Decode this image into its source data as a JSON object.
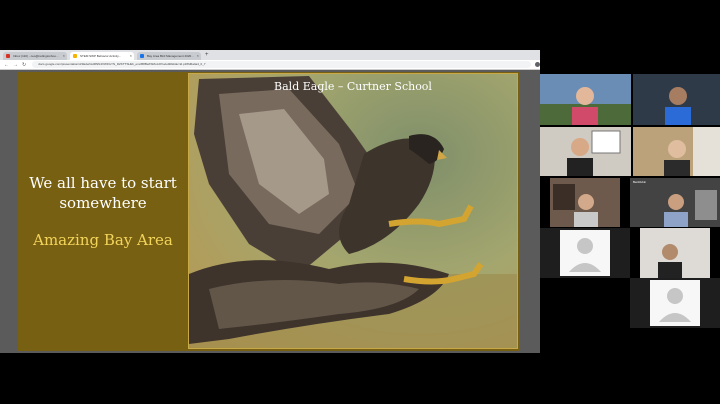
{
  "browser": {
    "tabs": [
      {
        "label": "Inbox (110) - ceo@redingtonboo..."
      },
      {
        "label": "STEM SWP Behavior Activity..."
      },
      {
        "label": "Bay Area Bird Management 2020..."
      }
    ],
    "new_tab": "+",
    "address": "docs.google.com/presentation/d/1EAwGHRNN4XWFGYN_DZKTTSHkb_emcB8BaXSMozAfVu/edit#slide=id.p1f8d6a4a4_0_7"
  },
  "slide": {
    "main_text_line1": "We all have to start",
    "main_text_line2": "somewhere",
    "subtitle": "Amazing Bay Area",
    "caption": "Bald Eagle – Curtner School"
  },
  "gallery": {
    "name_label": "BenRubin"
  },
  "colors": {
    "slide_bg": "#786012",
    "subtitle": "#f2d45c",
    "gallery_bg": "#000000"
  }
}
